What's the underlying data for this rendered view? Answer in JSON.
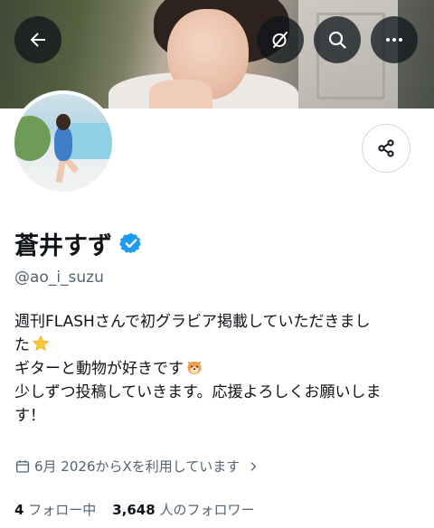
{
  "header": {
    "back_icon": "arrow-left-icon",
    "grok_icon": "grok-icon",
    "search_icon": "search-icon",
    "more_icon": "more-dots-icon"
  },
  "profile": {
    "display_name": "蒼井すず",
    "verified_icon": "verified-badge-icon",
    "verified_color": "#1d9bf0",
    "handle": "@ao_i_suzu",
    "bio": {
      "line1": "週刊FLASHさんで初グラビア掲載していただきまし",
      "line2": "た",
      "line2_emoji": "star-emoji",
      "line3": "ギターと動物が好きです",
      "line3_emoji": "dog-face-emoji",
      "line4": "少しずつ投稿していきます。応援よろしくお願いしま",
      "line5": "す！"
    },
    "joined": "6月 2026からXを利用しています",
    "joined_icon": "calendar-icon",
    "following_count": "4",
    "following_label": "フォロー中",
    "followers_count": "3,648",
    "followers_label": "人のフォロワー",
    "share_icon": "share-icon"
  },
  "colors": {
    "text_primary": "#0f1419",
    "text_secondary": "#536471",
    "accent": "#1d9bf0"
  }
}
